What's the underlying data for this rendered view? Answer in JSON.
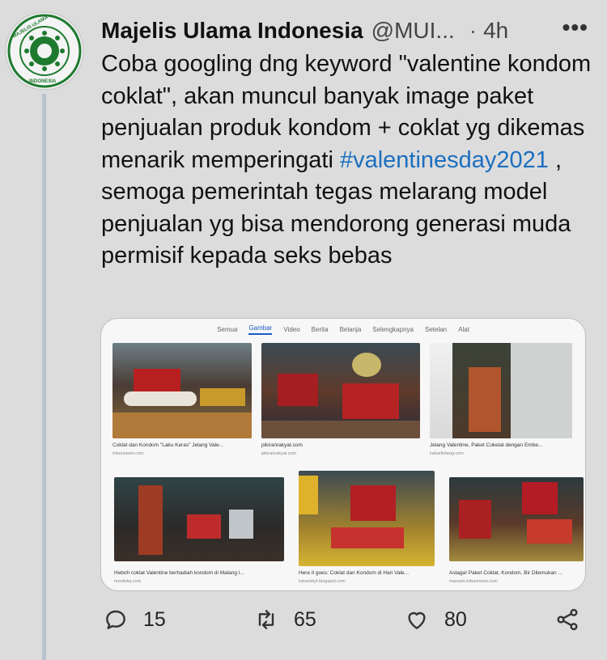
{
  "tweet": {
    "author": "Majelis Ulama Indonesia",
    "handle": "@MUI...",
    "separator": "·",
    "time": "4h",
    "more": "•••",
    "text_before": "Coba googling dng keyword \"valentine kondom coklat\", akan muncul banyak image paket penjualan produk kondom + coklat yg dikemas menarik memperingati ",
    "hashtag": "#valentinesday2021",
    "text_after": " , semoga pemerintah tegas melarang model penjualan yg bisa mendorong generasi muda permisif kepada seks bebas"
  },
  "media": {
    "tabs": [
      "Semua",
      "Gambar",
      "Video",
      "Berita",
      "Belanja",
      "Selengkapnya",
      "Setelan",
      "Alat"
    ],
    "active_tab": "Gambar",
    "results": [
      {
        "caption": "Coklat dan Kondom \"Laku Keras\" Jelang Vale...",
        "source": "tribunnews.com"
      },
      {
        "caption": "pikiranrakyat.com",
        "source": "pikiranrakyat.com"
      },
      {
        "caption": "Jelang Valentine, Paket Cokelat dengan Embe...",
        "source": "kabarlintang.com"
      },
      {
        "caption": "Heboh coklat Valentine berhadiah kondom di Malang l...",
        "source": "merdeka.com"
      },
      {
        "caption": "Here it goes: Coklat dan Kondom di Hari Vale...",
        "source": "travelsbyf.blogspot.com"
      },
      {
        "caption": "Astaga! Paket Coklat, Kondom, Bir Dilemukan ...",
        "source": "manado.tribunnews.com"
      }
    ]
  },
  "actions": {
    "replies": "15",
    "retweets": "65",
    "likes": "80"
  },
  "colors": {
    "background": "#dcdcdc",
    "hashtag": "#1b6fc0",
    "logo_green": "#1e7a2f"
  }
}
